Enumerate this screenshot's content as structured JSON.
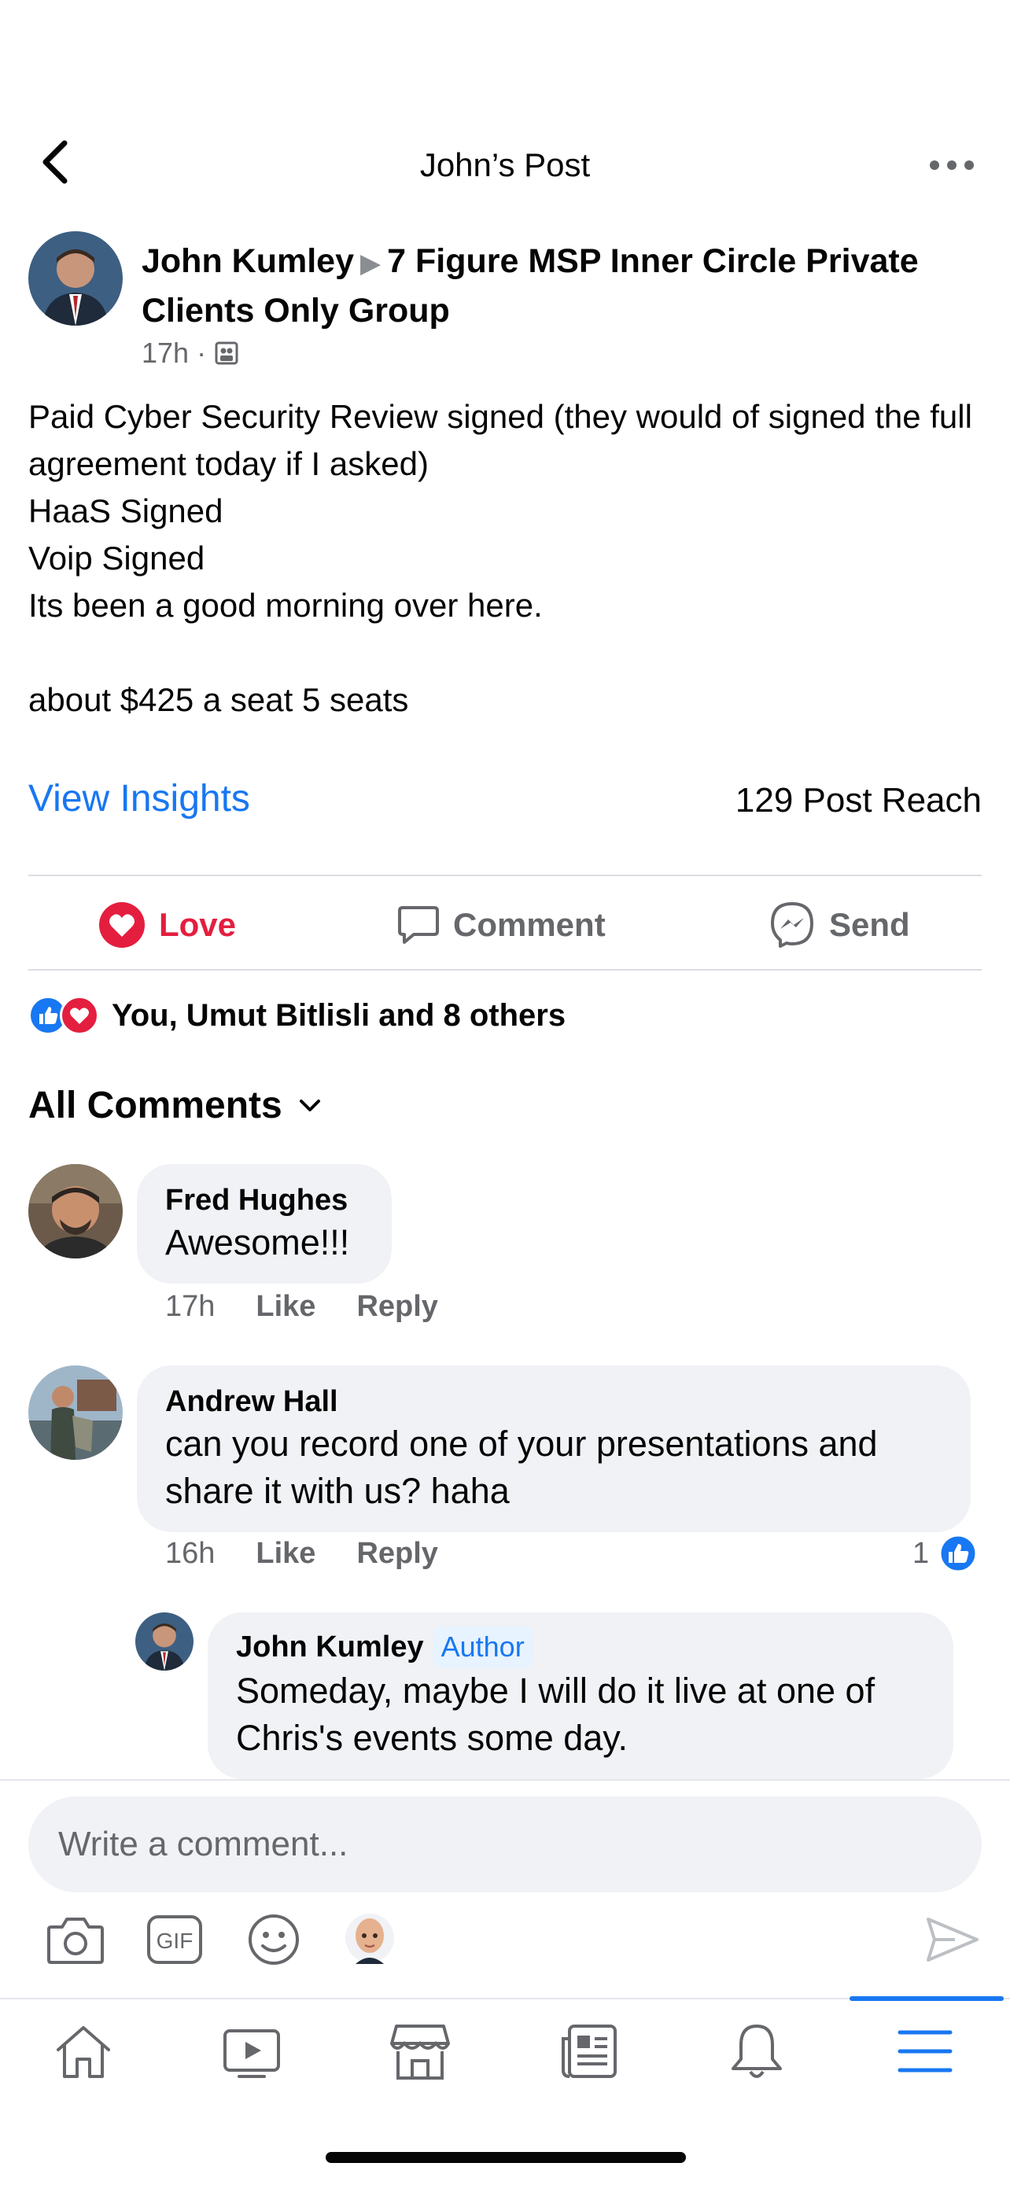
{
  "header": {
    "title": "John’s Post"
  },
  "post": {
    "author": "John Kumley",
    "group": "7 Figure MSP Inner Circle Private Clients Only Group",
    "time": "17h",
    "body": "Paid Cyber Security Review signed (they would of signed the full agreement today if I asked)\nHaaS Signed\nVoip Signed\nIts been a good morning over here.\n\nabout $425 a seat 5 seats",
    "insights_label": "View Insights",
    "reach": "129 Post Reach"
  },
  "actions": {
    "love": "Love",
    "comment": "Comment",
    "send": "Send"
  },
  "reactions": {
    "summary": "You, Umut Bitlisli and 8 others"
  },
  "comments_header": "All Comments",
  "comments": [
    {
      "name": "Fred Hughes",
      "text": "Awesome!!!",
      "time": "17h",
      "like": "Like",
      "reply": "Reply"
    },
    {
      "name": "Andrew Hall",
      "text": "can you record one of your presentations and share it with us? haha",
      "time": "16h",
      "like": "Like",
      "reply": "Reply",
      "like_count": "1"
    },
    {
      "name": "John Kumley",
      "badge": "Author",
      "text": "Someday, maybe I will do it live at one of Chris's events some day."
    }
  ],
  "composer": {
    "placeholder": "Write a comment..."
  },
  "colors": {
    "accent": "#1877f2",
    "love": "#e41e3f",
    "bubble": "#f0f2f5",
    "muted": "#65676b"
  }
}
